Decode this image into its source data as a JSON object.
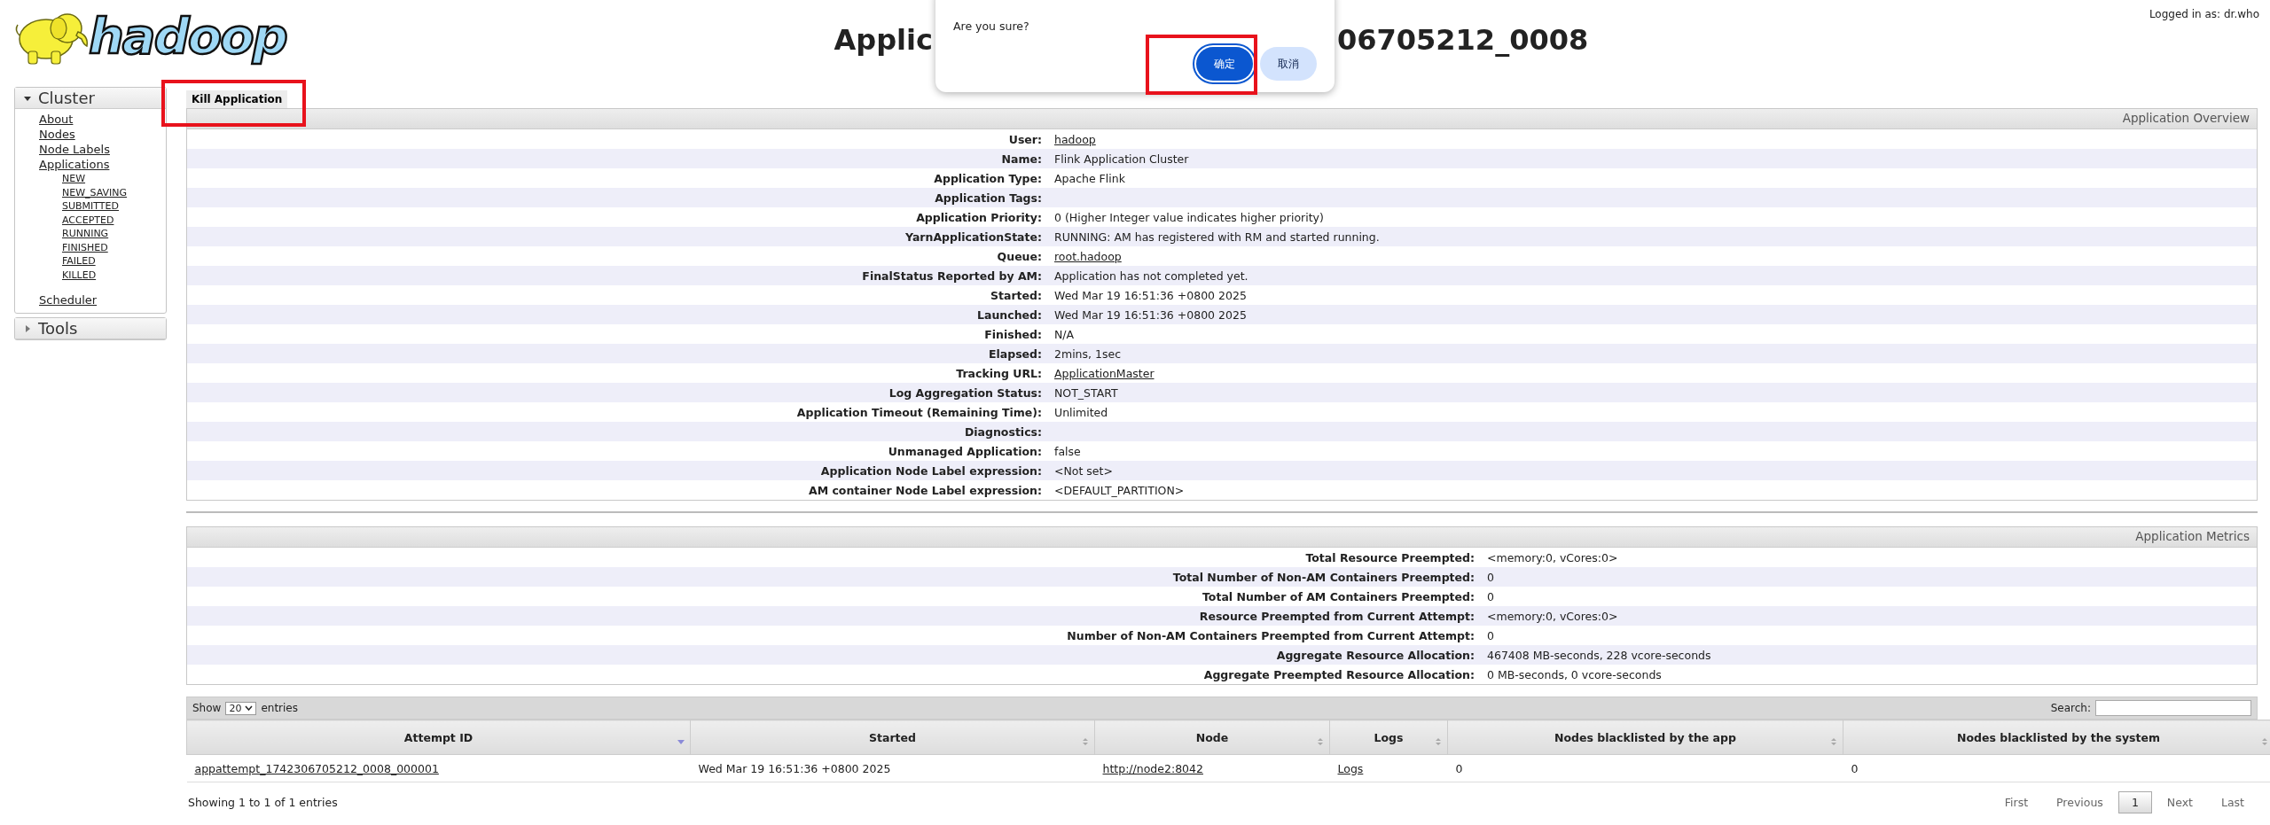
{
  "header": {
    "logo_text": "hadoop",
    "title_left": "Applic",
    "title_right": "06705212_0008",
    "login": "Logged in as: dr.who"
  },
  "dialog": {
    "message": "Are you sure?",
    "buttons": [
      {
        "label": "确定",
        "kind": "primary",
        "highlighted": true
      },
      {
        "label": "取消",
        "kind": "secondary",
        "highlighted": false
      }
    ]
  },
  "sidebar": {
    "sections": [
      {
        "title": "Cluster",
        "expanded": true,
        "items": [
          {
            "label": "About"
          },
          {
            "label": "Nodes"
          },
          {
            "label": "Node Labels"
          },
          {
            "label": "Applications",
            "children": [
              {
                "label": "NEW"
              },
              {
                "label": "NEW_SAVING"
              },
              {
                "label": "SUBMITTED"
              },
              {
                "label": "ACCEPTED"
              },
              {
                "label": "RUNNING"
              },
              {
                "label": "FINISHED"
              },
              {
                "label": "FAILED"
              },
              {
                "label": "KILLED"
              }
            ]
          },
          {
            "label": "Scheduler"
          }
        ]
      },
      {
        "title": "Tools",
        "expanded": false
      }
    ]
  },
  "kill_button": {
    "label": "Kill Application",
    "highlighted": true
  },
  "overview": {
    "title": "Application Overview",
    "rows": [
      {
        "label": "User:",
        "value": "hadoop",
        "link": true
      },
      {
        "label": "Name:",
        "value": "Flink Application Cluster",
        "link": false
      },
      {
        "label": "Application Type:",
        "value": "Apache Flink",
        "link": false
      },
      {
        "label": "Application Tags:"
      },
      {
        "label": "Application Priority:",
        "value": "0 (Higher Integer value indicates higher priority)",
        "link": false
      },
      {
        "label": "YarnApplicationState:",
        "value": "RUNNING: AM has registered with RM and started running.",
        "link": false
      },
      {
        "label": "Queue:",
        "value": "root.hadoop",
        "link": true
      },
      {
        "label": "FinalStatus Reported by AM:",
        "value": "Application has not completed yet.",
        "link": false
      },
      {
        "label": "Started:",
        "value": "Wed Mar 19 16:51:36 +0800 2025",
        "link": false
      },
      {
        "label": "Launched:",
        "value": "Wed Mar 19 16:51:36 +0800 2025",
        "link": false
      },
      {
        "label": "Finished:",
        "value": "N/A",
        "link": false
      },
      {
        "label": "Elapsed:",
        "value": "2mins, 1sec",
        "link": false
      },
      {
        "label": "Tracking URL:",
        "value": "ApplicationMaster",
        "link": true
      },
      {
        "label": "Log Aggregation Status:",
        "value": "NOT_START",
        "link": false
      },
      {
        "label": "Application Timeout (Remaining Time):",
        "value": "Unlimited",
        "link": false
      },
      {
        "label": "Diagnostics:"
      },
      {
        "label": "Unmanaged Application:",
        "value": "false",
        "link": false
      },
      {
        "label": "Application Node Label expression:",
        "value": "<Not set>",
        "link": false
      },
      {
        "label": "AM container Node Label expression:",
        "value": "<DEFAULT_PARTITION>",
        "link": false
      }
    ]
  },
  "metrics": {
    "title": "Application Metrics",
    "rows": [
      {
        "label": "Total Resource Preempted:",
        "value": "<memory:0, vCores:0>"
      },
      {
        "label": "Total Number of Non-AM Containers Preempted:",
        "value": "0"
      },
      {
        "label": "Total Number of AM Containers Preempted:",
        "value": "0"
      },
      {
        "label": "Resource Preempted from Current Attempt:",
        "value": "<memory:0, vCores:0>"
      },
      {
        "label": "Number of Non-AM Containers Preempted from Current Attempt:",
        "value": "0"
      },
      {
        "label": "Aggregate Resource Allocation:",
        "value": "467408 MB-seconds, 228 vcore-seconds"
      },
      {
        "label": "Aggregate Preempted Resource Allocation:",
        "value": "0 MB-seconds, 0 vcore-seconds"
      }
    ]
  },
  "attempts": {
    "show_label": "Show",
    "page_size": "20",
    "entries_label": "entries",
    "search_label": "Search:",
    "columns": [
      {
        "label": "Attempt ID",
        "sorted": true
      },
      {
        "label": "Started",
        "sorted": false
      },
      {
        "label": "Node",
        "sorted": false
      },
      {
        "label": "Logs",
        "sorted": false
      },
      {
        "label": "Nodes blacklisted by the app",
        "sorted": false
      },
      {
        "label": "Nodes blacklisted by the system",
        "sorted": false
      }
    ],
    "rows": [
      {
        "cells": [
          {
            "text": "appattempt_1742306705212_0008_000001",
            "link": true
          },
          {
            "text": "Wed Mar 19 16:51:36 +0800 2025",
            "link": false
          },
          {
            "text": "http://node2:8042",
            "link": true
          },
          {
            "text": "Logs",
            "link": true
          },
          {
            "text": "0",
            "link": false
          },
          {
            "text": "0",
            "link": false
          }
        ]
      }
    ],
    "info": "Showing 1 to 1 of 1 entries",
    "pages": [
      {
        "label": "First",
        "kind": "nav",
        "selected": false
      },
      {
        "label": "Previous",
        "kind": "nav",
        "selected": false
      },
      {
        "label": "1",
        "kind": "number",
        "selected": true
      },
      {
        "label": "Next",
        "kind": "nav",
        "selected": false
      },
      {
        "label": "Last",
        "kind": "nav",
        "selected": false
      }
    ]
  }
}
